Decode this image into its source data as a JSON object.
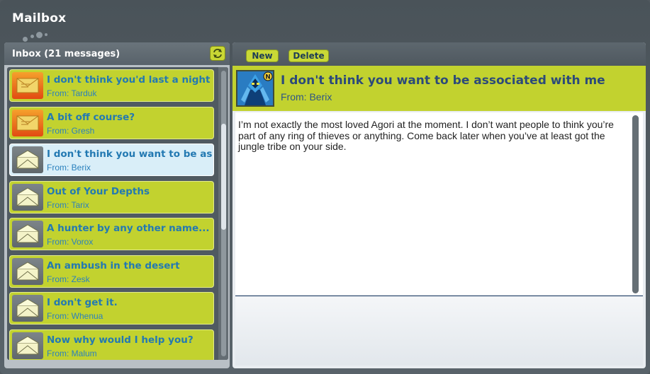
{
  "window": {
    "title": "Mailbox"
  },
  "inbox": {
    "title": "Inbox (21 messages)",
    "messages": [
      {
        "subject": "I don't think you'd last a night in th",
        "from": "From: Tarduk",
        "unread": true
      },
      {
        "subject": "A bit off course?",
        "from": "From: Gresh",
        "unread": true
      },
      {
        "subject": "I don't think you want to be associ",
        "from": "From: Berix",
        "unread": false,
        "selected": true
      },
      {
        "subject": "Out of Your Depths",
        "from": "From: Tarix",
        "unread": false
      },
      {
        "subject": "A hunter by any other name...",
        "from": "From: Vorox",
        "unread": false
      },
      {
        "subject": "An ambush in the desert",
        "from": "From: Zesk",
        "unread": false
      },
      {
        "subject": "I don't get it.",
        "from": "From: Whenua",
        "unread": false
      },
      {
        "subject": "Now why would I help you?",
        "from": "From: Malum",
        "unread": false
      }
    ]
  },
  "toolbar": {
    "new_label": "New",
    "delete_label": "Delete"
  },
  "message": {
    "subject": "I don't think you want to be associated with me",
    "from": "From: Berix",
    "body": "I’m not exactly the most loved Agori at the moment. I don’t want people to think you’re part of any ring of thieves or anything. Come back later when you’ve at least got the jungle tribe on your side."
  },
  "icons": {
    "unread_envelope": "envelope-icon",
    "read_envelope": "open-envelope-icon",
    "refresh": "refresh-icon"
  },
  "colors": {
    "accent": "#c2d22f",
    "link_blue": "#2379b2",
    "frame": "#50585e"
  }
}
